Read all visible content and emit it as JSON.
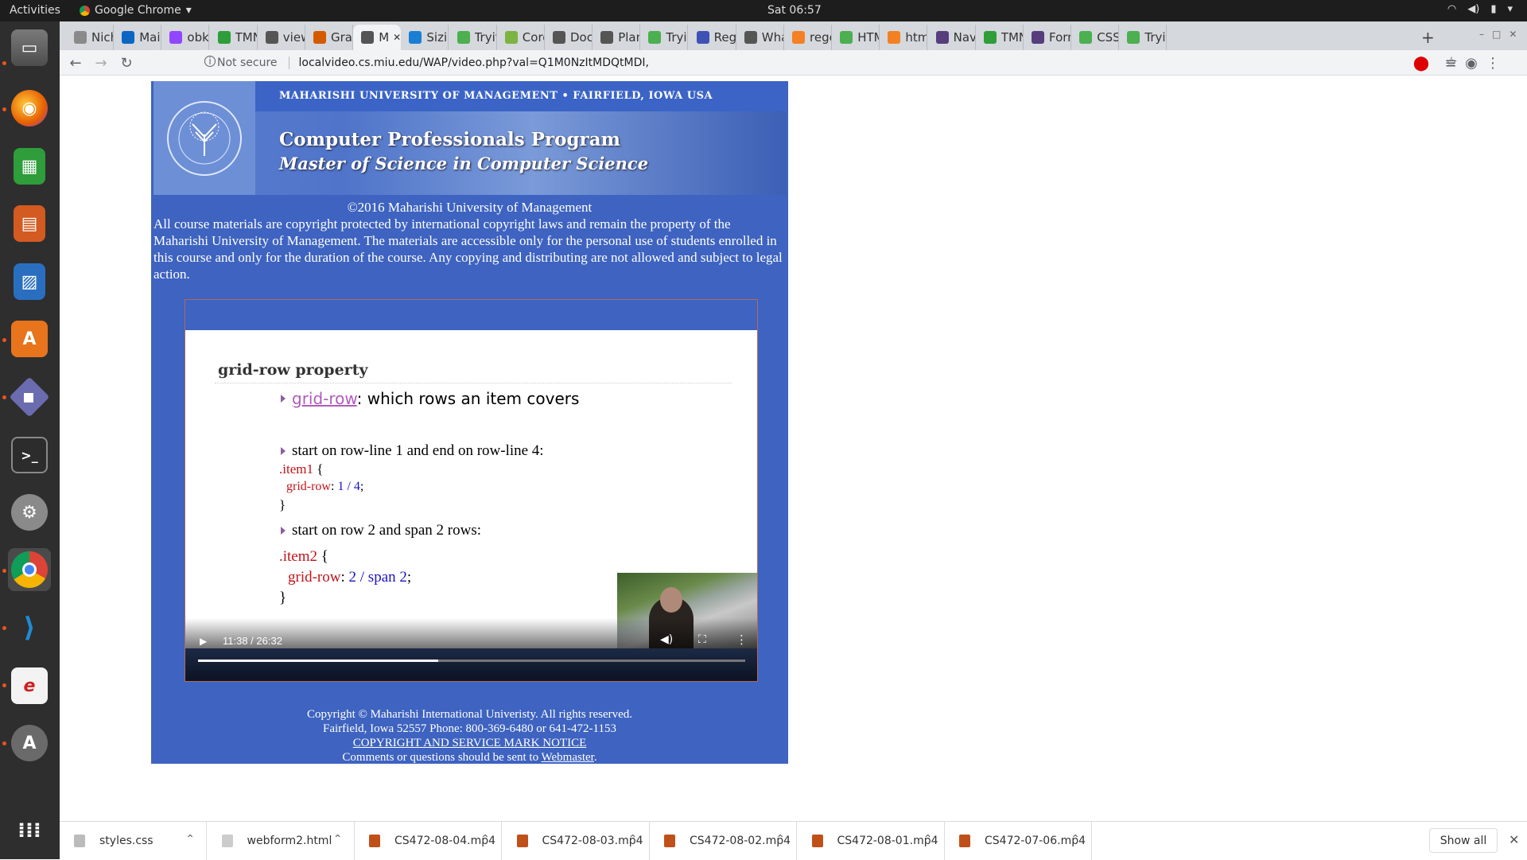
{
  "topbar": {
    "activities": "Activities",
    "app_name": "Google Chrome",
    "clock": "Sat 06:57"
  },
  "dock": {
    "items": [
      "files-icon",
      "firefox-icon",
      "spreadsheet-icon",
      "presentation-icon",
      "image-viewer-icon",
      "software-center-icon",
      "diagram-icon",
      "terminal-icon",
      "settings-icon",
      "chrome-icon",
      "vscode-icon",
      "pdf-reader-icon",
      "updater-icon",
      "apps-grid-icon"
    ]
  },
  "tabs": [
    {
      "label": "Nich",
      "color": "#8a8a8a"
    },
    {
      "label": "Mail",
      "color": "#0a66c2"
    },
    {
      "label": "obka",
      "color": "#9146ff"
    },
    {
      "label": "TMN",
      "color": "#2e9d3a"
    },
    {
      "label": "view",
      "color": "#555555"
    },
    {
      "label": "Gran",
      "color": "#d45a00"
    },
    {
      "label": "M",
      "color": "#555555"
    },
    {
      "label": "Sizin",
      "color": "#1a7fd4"
    },
    {
      "label": "Tryit",
      "color": "#4caf50"
    },
    {
      "label": "Coro",
      "color": "#7cb342"
    },
    {
      "label": "Docu",
      "color": "#555555"
    },
    {
      "label": "Plan",
      "color": "#555555"
    },
    {
      "label": "Tryit",
      "color": "#4caf50"
    },
    {
      "label": "Regu",
      "color": "#3f51b5"
    },
    {
      "label": "Wha",
      "color": "#555555"
    },
    {
      "label": "rege",
      "color": "#f48024"
    },
    {
      "label": "HTM",
      "color": "#4caf50"
    },
    {
      "label": "html",
      "color": "#f48024"
    },
    {
      "label": "Navt",
      "color": "#563d7c"
    },
    {
      "label": "TMN",
      "color": "#2e9d3a"
    },
    {
      "label": "Forn",
      "color": "#563d7c"
    },
    {
      "label": "CSS",
      "color": "#4caf50"
    },
    {
      "label": "Tryit",
      "color": "#4caf50"
    }
  ],
  "omnibox": {
    "security": "Not secure",
    "url": "localvideo.cs.miu.edu/WAP/video.php?val=Q1M0NzItMDQtMDI,"
  },
  "banner": {
    "top_line": "MAHARISHI UNIVERSITY OF MANAGEMENT • FAIRFIELD, IOWA USA",
    "title": "Computer Professionals Program",
    "subtitle": "Master of Science in Computer Science"
  },
  "notice": {
    "copyright": "©2016 Maharishi University of Management",
    "body": "All course materials are copyright protected by international copyright laws and remain the property of the Maharishi University of Management. The materials are accessible only for the personal use of students enrolled in this course and only for the duration of the course. Any copying and distributing are not allowed and subject to legal action."
  },
  "slide": {
    "title": "grid-row property",
    "bullet1_link": "grid-row",
    "bullet1_text": ":  which rows an item covers",
    "bullet2": "start on row-line 1 and end on row-line 4:",
    "code1_sel": ".item1",
    "code1_open": " {",
    "code1_prop": "grid-row",
    "code1_colon": ": ",
    "code1_val": "1 / 4",
    "code1_semi": ";",
    "code1_close": "}",
    "bullet3": "start on row 2 and span 2 rows:",
    "code2_sel": ".item2",
    "code2_open": "  {",
    "code2_prop": "grid-row",
    "code2_colon": ": ",
    "code2_val1": "2",
    "code2_slash": " / ",
    "code2_val2": "span 2",
    "code2_semi": ";",
    "code2_close": "}"
  },
  "player": {
    "time": "11:38 / 26:32",
    "progress": 0.4386
  },
  "footer": {
    "line1": "Copyright © Maharishi International Univeristy. All rights reserved.",
    "line2": "Fairfield, Iowa 52557 Phone: 800-369-6480 or 641-472-1153",
    "notice_link": "COPYRIGHT AND SERVICE MARK NOTICE",
    "line4": "Comments or questions should be sent to ",
    "webmaster": "Webmaster",
    "period": "."
  },
  "downloads": {
    "items": [
      {
        "name": "styles.css",
        "color": "#bbbbbb"
      },
      {
        "name": "webform2.html",
        "color": "#cccccc"
      },
      {
        "name": "CS472-08-04.mp4",
        "color": "#c0501a"
      },
      {
        "name": "CS472-08-03.mp4",
        "color": "#c0501a"
      },
      {
        "name": "CS472-08-02.mp4",
        "color": "#c0501a"
      },
      {
        "name": "CS472-08-01.mp4",
        "color": "#c0501a"
      },
      {
        "name": "CS472-07-06.mp4",
        "color": "#c0501a"
      }
    ],
    "show_all": "Show all"
  }
}
